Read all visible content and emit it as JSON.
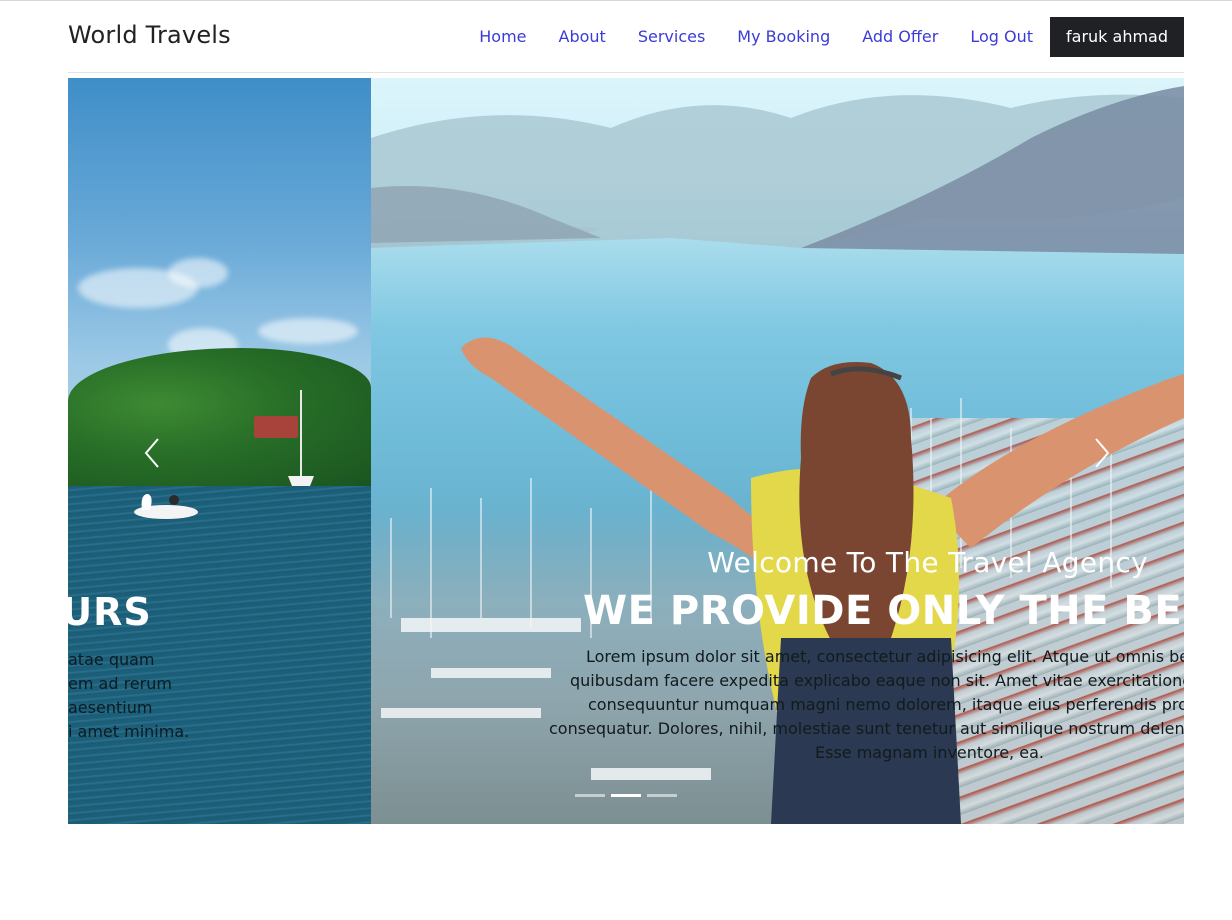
{
  "header": {
    "brand": "World Travels",
    "nav": {
      "home": "Home",
      "about": "About",
      "services": "Services",
      "my_booking": "My Booking",
      "add_offer": "Add Offer",
      "logout": "Log Out"
    },
    "user_name": "faruk ahmad"
  },
  "carousel": {
    "previous_slide": {
      "heading_visible": "OURS",
      "text_lines": [
        "atae quam",
        "em ad rerum",
        "aesentium",
        "i amet minima."
      ]
    },
    "active_slide": {
      "subtitle": "Welcome To The Travel Agency",
      "title": "WE PROVIDE ONLY THE BEST TO",
      "text_lines": [
        "Lorem ipsum dolor sit amet, consectetur adipisicing elit. Atque ut omnis bea",
        "quibusdam facere expedita explicabo eaque non sit. Amet vitae exercitatione",
        "consequuntur numquam magni nemo dolorem, itaque eius perferendis pro",
        "consequatur. Dolores, nihil, molestiae sunt tenetur aut similique nostrum delenit",
        "Esse magnam inventore, ea."
      ]
    },
    "indicators": {
      "count": 3,
      "active_index": 1
    },
    "controls": {
      "prev_icon": "chevron-left-icon",
      "next_icon": "chevron-right-icon"
    }
  },
  "colors": {
    "nav_link": "#3b3bd6",
    "brand_text": "#222222",
    "user_button_bg": "#1f2125",
    "user_button_text": "#ffffff"
  }
}
